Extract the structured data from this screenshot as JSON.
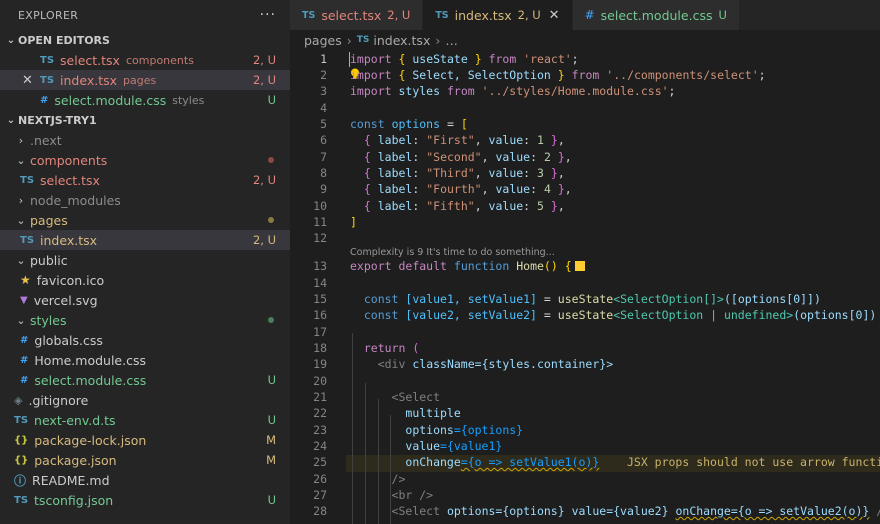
{
  "explorer": {
    "title": "EXPLORER",
    "more": "···",
    "open_editors": {
      "label": "OPEN EDITORS",
      "items": [
        {
          "icon": "TS",
          "name": "select.tsx",
          "desc": "components",
          "status": "2, U"
        },
        {
          "icon": "TS",
          "name": "index.tsx",
          "desc": "pages",
          "status": "2, U",
          "close": "✕"
        },
        {
          "icon": "#",
          "name": "select.module.css",
          "desc": "styles",
          "status": "U"
        }
      ]
    },
    "project": {
      "label": "NEXTJS-TRY1",
      "tree": [
        {
          "chev": "›",
          "name": ".next"
        },
        {
          "chev": "⌄",
          "name": "components"
        },
        {
          "icon": "TS",
          "name": "select.tsx",
          "status": "2, U"
        },
        {
          "chev": "›",
          "name": "node_modules"
        },
        {
          "chev": "⌄",
          "name": "pages"
        },
        {
          "icon": "TS",
          "name": "index.tsx",
          "status": "2, U"
        },
        {
          "chev": "⌄",
          "name": "public"
        },
        {
          "icon": "★",
          "name": "favicon.ico"
        },
        {
          "icon": "▼",
          "name": "vercel.svg"
        },
        {
          "chev": "⌄",
          "name": "styles"
        },
        {
          "icon": "#",
          "name": "globals.css"
        },
        {
          "icon": "#",
          "name": "Home.module.css"
        },
        {
          "icon": "#",
          "name": "select.module.css",
          "status": "U"
        },
        {
          "icon": "◈",
          "name": ".gitignore"
        },
        {
          "icon": "TS",
          "name": "next-env.d.ts",
          "status": "U"
        },
        {
          "icon": "{}",
          "name": "package-lock.json",
          "status": "M"
        },
        {
          "icon": "{}",
          "name": "package.json",
          "status": "M"
        },
        {
          "icon": "ⓘ",
          "name": "README.md"
        },
        {
          "icon": "TS",
          "name": "tsconfig.json",
          "status": "U"
        }
      ]
    }
  },
  "tabs": [
    {
      "icon": "TS",
      "name": "select.tsx",
      "status": "2, U"
    },
    {
      "icon": "TS",
      "name": "index.tsx",
      "status": "2, U",
      "close": "✕"
    },
    {
      "icon": "#",
      "name": "select.module.css",
      "status": "U"
    }
  ],
  "breadcrumb": {
    "folder": "pages",
    "sep": "›",
    "file_icon": "TS",
    "file": "index.tsx",
    "tail": "…"
  },
  "code_lens": "Complexity is 9 It's time to do something...",
  "inline_warning": "JSX props should not use arrow functions",
  "line_numbers": [
    "1",
    "2",
    "3",
    "4",
    "5",
    "6",
    "7",
    "8",
    "9",
    "10",
    "11",
    "12",
    "13",
    "14",
    "15",
    "16",
    "17",
    "18",
    "19",
    "20",
    "21",
    "22",
    "23",
    "24",
    "25",
    "26",
    "27",
    "28"
  ],
  "code": {
    "l1": [
      "import",
      "{",
      "useState",
      "}",
      "from",
      "'react'",
      ";"
    ],
    "l2": [
      "import",
      "{",
      "Select, SelectOption",
      "}",
      "from",
      "'../components/select'",
      ";"
    ],
    "l3": [
      "import",
      "styles",
      "from",
      "'../styles/Home.module.css'",
      ";"
    ],
    "l5": [
      "const",
      "options",
      "=",
      "["
    ],
    "opts": [
      {
        "label": "\"First\"",
        "value": "1"
      },
      {
        "label": "\"Second\"",
        "value": "2"
      },
      {
        "label": "\"Third\"",
        "value": "3"
      },
      {
        "label": "\"Fourth\"",
        "value": "4"
      },
      {
        "label": "\"Fifth\"",
        "value": "5"
      }
    ],
    "l11": "]",
    "l13": [
      "export",
      "default",
      "function",
      "Home",
      "()",
      "{"
    ],
    "l15": [
      "const",
      "[value1, setValue1]",
      "=",
      "useState",
      "<SelectOption[]>",
      "([options[0]])"
    ],
    "l16": [
      "const",
      "[value2, setValue2]",
      "=",
      "useState",
      "<SelectOption | undefined>",
      "(options[0])"
    ],
    "l18": [
      "return",
      "("
    ],
    "l19": [
      "<div",
      "className",
      "={styles.container}>"
    ],
    "l21": "<Select",
    "l22": "multiple",
    "l23": [
      "options",
      "={options}"
    ],
    "l24": [
      "value",
      "={value1}"
    ],
    "l25": [
      "onChange",
      "={o => setValue1(o)}"
    ],
    "l26": "/>",
    "l27": "<br />",
    "l28": [
      "<Select",
      "options={options}",
      "value={value2}",
      "onChange={o => setValue2(o)}",
      "/>"
    ]
  }
}
